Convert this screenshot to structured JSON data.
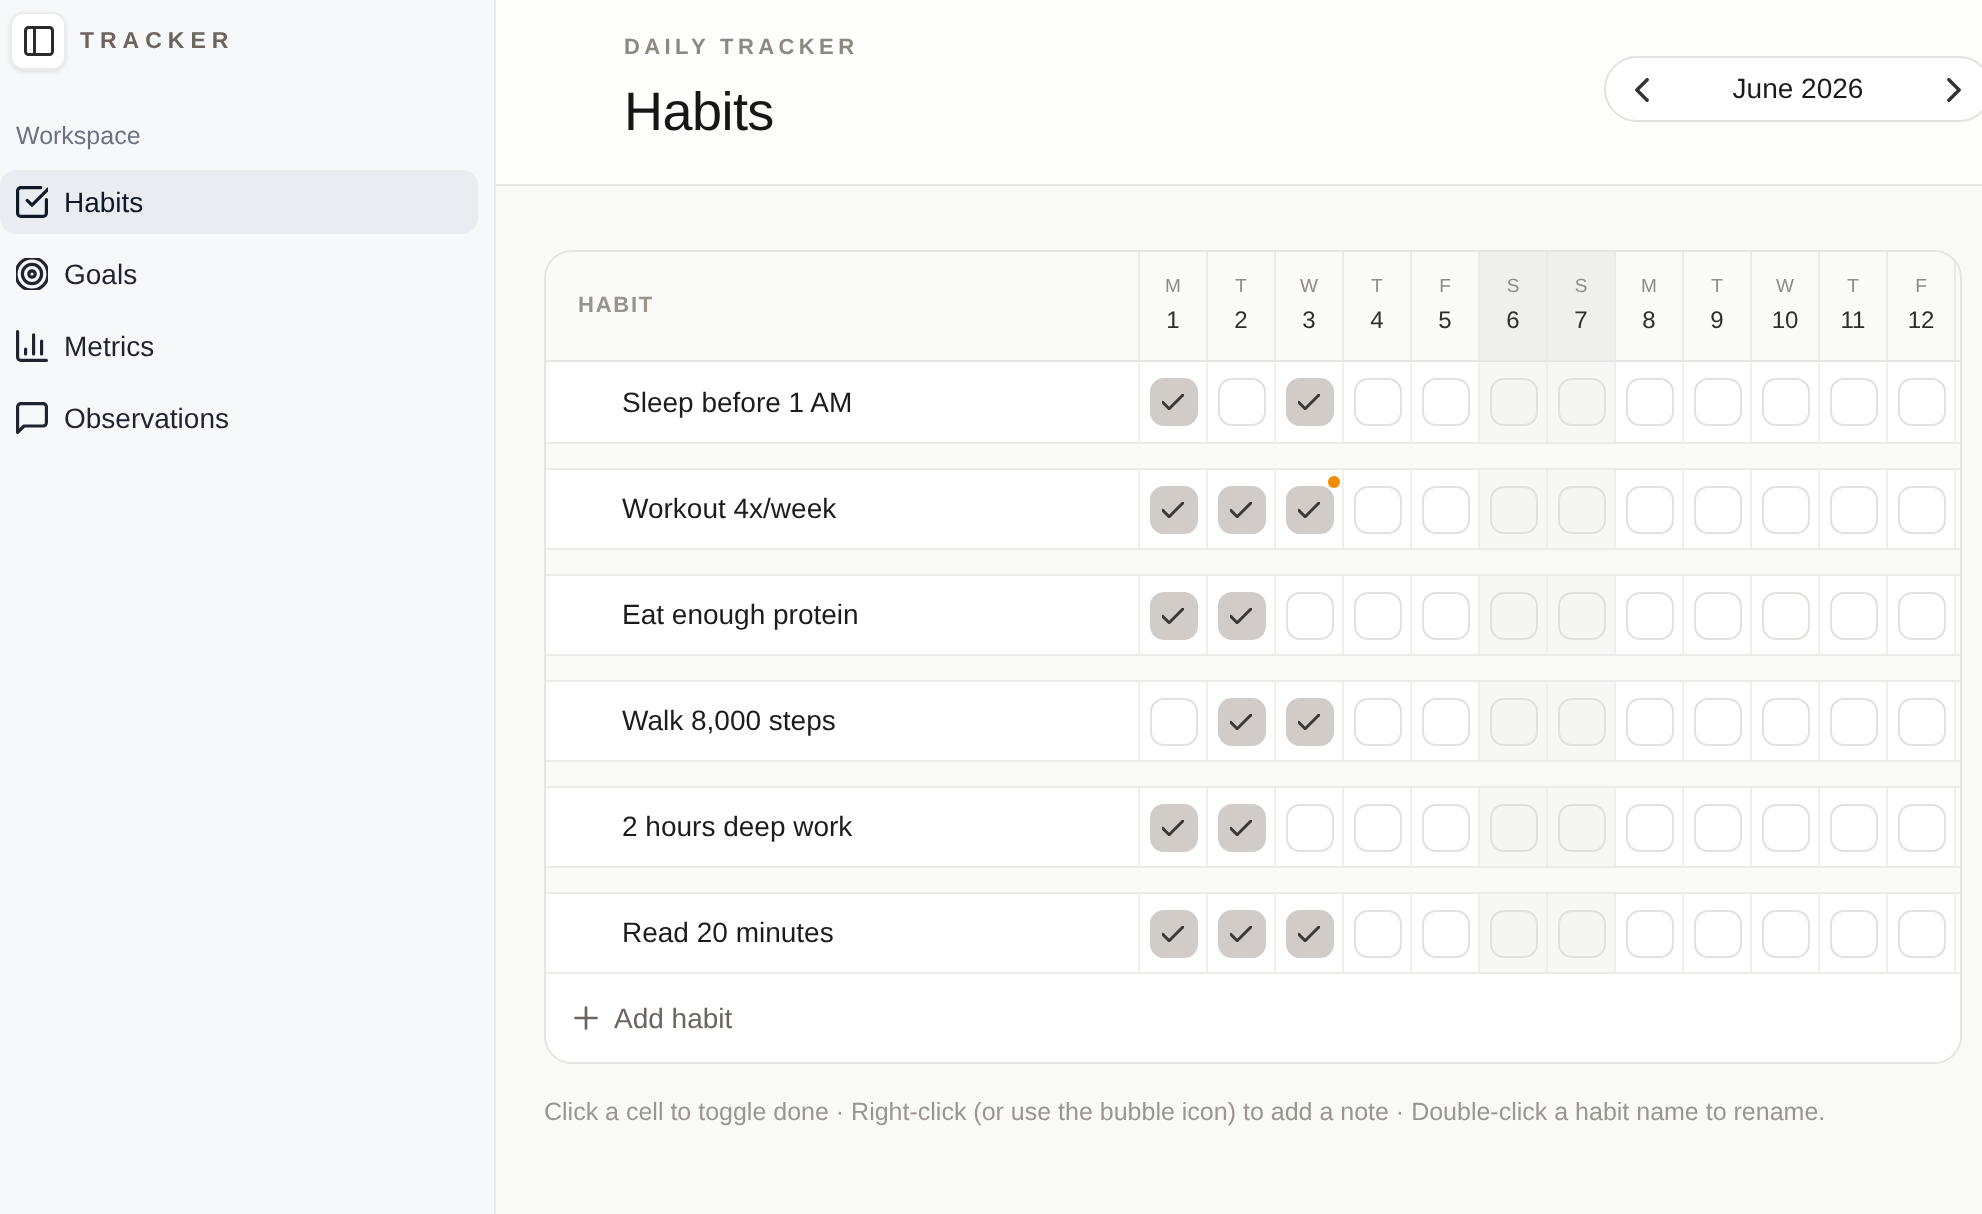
{
  "sidebar": {
    "brand": "TRACKER",
    "section_label": "Workspace",
    "items": [
      {
        "label": "Habits",
        "selected": true
      },
      {
        "label": "Goals",
        "selected": false
      },
      {
        "label": "Metrics",
        "selected": false
      },
      {
        "label": "Observations",
        "selected": false
      }
    ]
  },
  "header": {
    "eyebrow": "DAILY TRACKER",
    "title": "Habits",
    "month": "June 2026"
  },
  "table": {
    "habit_column": "HABIT",
    "days": [
      {
        "weekday": "M",
        "date": "1",
        "weekend": false
      },
      {
        "weekday": "T",
        "date": "2",
        "weekend": false
      },
      {
        "weekday": "W",
        "date": "3",
        "weekend": false
      },
      {
        "weekday": "T",
        "date": "4",
        "weekend": false
      },
      {
        "weekday": "F",
        "date": "5",
        "weekend": false
      },
      {
        "weekday": "S",
        "date": "6",
        "weekend": true
      },
      {
        "weekday": "S",
        "date": "7",
        "weekend": true
      },
      {
        "weekday": "M",
        "date": "8",
        "weekend": false
      },
      {
        "weekday": "T",
        "date": "9",
        "weekend": false
      },
      {
        "weekday": "W",
        "date": "10",
        "weekend": false
      },
      {
        "weekday": "T",
        "date": "11",
        "weekend": false
      },
      {
        "weekday": "F",
        "date": "12",
        "weekend": false
      }
    ],
    "habits": [
      {
        "name": "Sleep before 1 AM",
        "cells": [
          {
            "done": true,
            "note": false
          },
          {
            "done": false,
            "note": false
          },
          {
            "done": true,
            "note": false
          },
          {
            "done": false,
            "note": false
          },
          {
            "done": false,
            "note": false
          },
          {
            "done": false,
            "note": false
          },
          {
            "done": false,
            "note": false
          },
          {
            "done": false,
            "note": false
          },
          {
            "done": false,
            "note": false
          },
          {
            "done": false,
            "note": false
          },
          {
            "done": false,
            "note": false
          },
          {
            "done": false,
            "note": false
          }
        ]
      },
      {
        "name": "Workout 4x/week",
        "cells": [
          {
            "done": true,
            "note": false
          },
          {
            "done": true,
            "note": false
          },
          {
            "done": true,
            "note": true
          },
          {
            "done": false,
            "note": false
          },
          {
            "done": false,
            "note": false
          },
          {
            "done": false,
            "note": false
          },
          {
            "done": false,
            "note": false
          },
          {
            "done": false,
            "note": false
          },
          {
            "done": false,
            "note": false
          },
          {
            "done": false,
            "note": false
          },
          {
            "done": false,
            "note": false
          },
          {
            "done": false,
            "note": false
          }
        ]
      },
      {
        "name": "Eat enough protein",
        "cells": [
          {
            "done": true,
            "note": false
          },
          {
            "done": true,
            "note": false
          },
          {
            "done": false,
            "note": false
          },
          {
            "done": false,
            "note": false
          },
          {
            "done": false,
            "note": false
          },
          {
            "done": false,
            "note": false
          },
          {
            "done": false,
            "note": false
          },
          {
            "done": false,
            "note": false
          },
          {
            "done": false,
            "note": false
          },
          {
            "done": false,
            "note": false
          },
          {
            "done": false,
            "note": false
          },
          {
            "done": false,
            "note": false
          }
        ]
      },
      {
        "name": "Walk 8,000 steps",
        "cells": [
          {
            "done": false,
            "note": false
          },
          {
            "done": true,
            "note": false
          },
          {
            "done": true,
            "note": false
          },
          {
            "done": false,
            "note": false
          },
          {
            "done": false,
            "note": false
          },
          {
            "done": false,
            "note": false
          },
          {
            "done": false,
            "note": false
          },
          {
            "done": false,
            "note": false
          },
          {
            "done": false,
            "note": false
          },
          {
            "done": false,
            "note": false
          },
          {
            "done": false,
            "note": false
          },
          {
            "done": false,
            "note": false
          }
        ]
      },
      {
        "name": "2 hours deep work",
        "cells": [
          {
            "done": true,
            "note": false
          },
          {
            "done": true,
            "note": false
          },
          {
            "done": false,
            "note": false
          },
          {
            "done": false,
            "note": false
          },
          {
            "done": false,
            "note": false
          },
          {
            "done": false,
            "note": false
          },
          {
            "done": false,
            "note": false
          },
          {
            "done": false,
            "note": false
          },
          {
            "done": false,
            "note": false
          },
          {
            "done": false,
            "note": false
          },
          {
            "done": false,
            "note": false
          },
          {
            "done": false,
            "note": false
          }
        ]
      },
      {
        "name": "Read 20 minutes",
        "cells": [
          {
            "done": true,
            "note": false
          },
          {
            "done": true,
            "note": false
          },
          {
            "done": true,
            "note": false
          },
          {
            "done": false,
            "note": false
          },
          {
            "done": false,
            "note": false
          },
          {
            "done": false,
            "note": false
          },
          {
            "done": false,
            "note": false
          },
          {
            "done": false,
            "note": false
          },
          {
            "done": false,
            "note": false
          },
          {
            "done": false,
            "note": false
          },
          {
            "done": false,
            "note": false
          },
          {
            "done": false,
            "note": false
          }
        ]
      }
    ],
    "add_label": "Add habit"
  },
  "hint": "Click a cell to toggle done · Right-click (or use the bubble icon) to add a note · Double-click a habit name to rename."
}
